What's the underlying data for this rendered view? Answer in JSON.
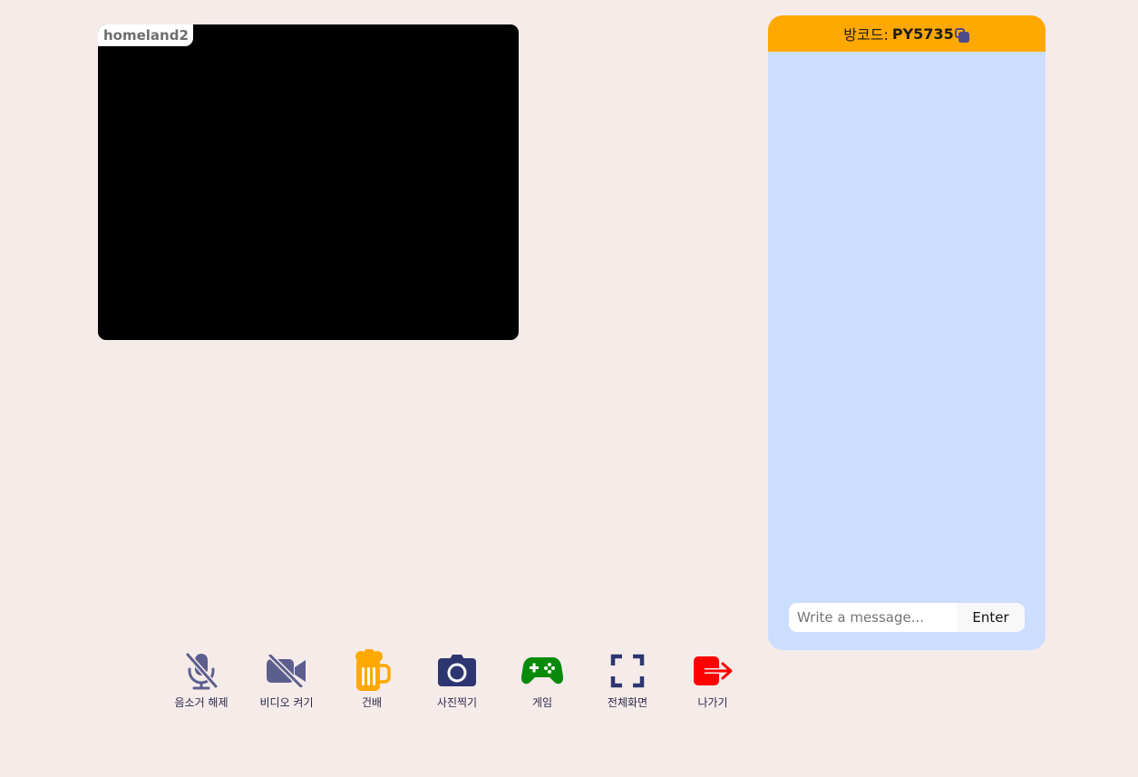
{
  "video": {
    "participant_name": "homeland2",
    "background_color": "#000000"
  },
  "chat": {
    "room_code_label": "방코드:",
    "room_code": "PY5735",
    "header_color": "#ffa800",
    "panel_color": "#ccdeff",
    "copy_icon": "copy-icon",
    "input_placeholder": "Write a message...",
    "enter_label": "Enter"
  },
  "toolbar": {
    "items": [
      {
        "label": "음소거 해제",
        "icon": "mic-off-icon",
        "color": "#5c5f8e"
      },
      {
        "label": "비디오 켜기",
        "icon": "video-off-icon",
        "color": "#5c5f8e"
      },
      {
        "label": "건배",
        "icon": "beer-icon",
        "color": "#ffa800"
      },
      {
        "label": "사진찍기",
        "icon": "camera-icon",
        "color": "#2d3670"
      },
      {
        "label": "게임",
        "icon": "gamepad-icon",
        "color": "#0a8a0a"
      },
      {
        "label": "전체화면",
        "icon": "fullscreen-icon",
        "color": "#2d3670"
      },
      {
        "label": "나가기",
        "icon": "exit-icon",
        "color": "#ff0000"
      }
    ]
  }
}
